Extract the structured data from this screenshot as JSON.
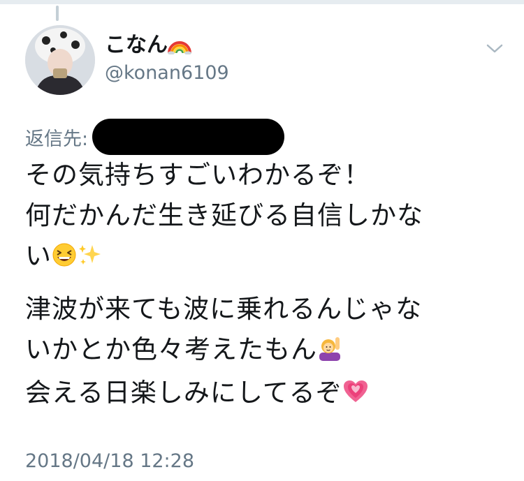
{
  "tweet": {
    "author": {
      "display_name": "こなん",
      "handle": "@konan6109",
      "name_emoji": "rainbow-emoji"
    },
    "menu_icon": "chevron-down-icon",
    "reply_to": {
      "label": "返信先:",
      "redacted": true
    },
    "body": {
      "p1_line1": "その気持ちすごいわかるぞ！",
      "p1_line2": "何だかんだ生き延びる自信しかな",
      "p1_line3": "い",
      "p1_emoji": [
        "grinning-squinting-face-emoji",
        "sparkles-emoji"
      ],
      "p2_line1": "津波が来ても波に乗れるんじゃな",
      "p2_line2": "いかとか色々考えたもん",
      "p2_emoji": "person-raising-hand-emoji",
      "p2_line3": "会える日楽しみにしてるぞ",
      "p2_emoji_end": "growing-heart-emoji"
    },
    "timestamp": "2018/04/18 12:28"
  },
  "colors": {
    "text": "#14171a",
    "secondary": "#657786",
    "divider": "#e6ecf0"
  }
}
